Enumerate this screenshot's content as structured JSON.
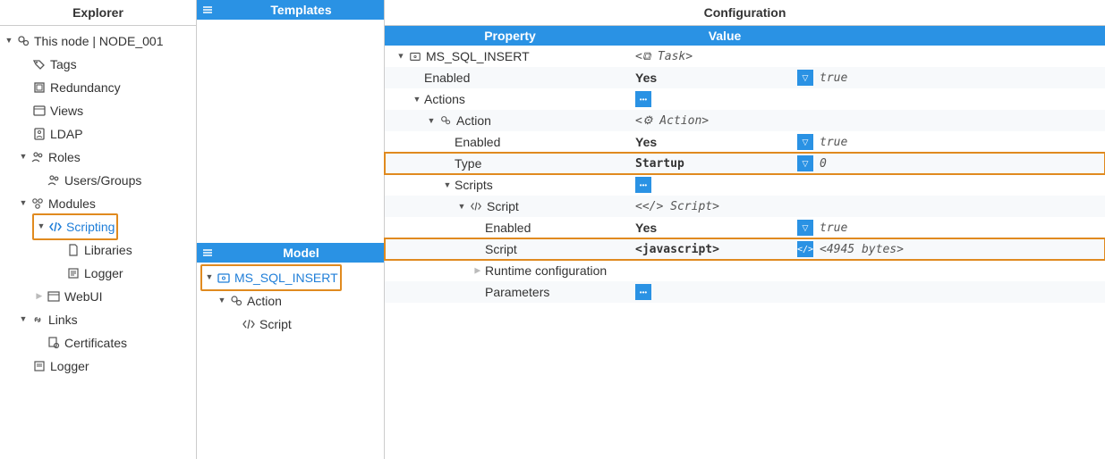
{
  "explorer": {
    "title": "Explorer",
    "node": "This node | NODE_001",
    "items": {
      "tags": "Tags",
      "redundancy": "Redundancy",
      "views": "Views",
      "ldap": "LDAP",
      "roles": "Roles",
      "usersgroups": "Users/Groups",
      "modules": "Modules",
      "scripting": "Scripting",
      "libraries": "Libraries",
      "logger": "Logger",
      "webui": "WebUI",
      "links": "Links",
      "certificates": "Certificates",
      "logger2": "Logger"
    }
  },
  "mid": {
    "templates_title": "Templates",
    "model_title": "Model",
    "model": {
      "root": "MS_SQL_INSERT",
      "action": "Action",
      "script": "Script"
    }
  },
  "config": {
    "title": "Configuration",
    "headers": {
      "property": "Property",
      "value": "Value"
    },
    "rows": {
      "root": {
        "p": "MS_SQL_INSERT",
        "v": "<⧉ Task>"
      },
      "enabled1": {
        "p": "Enabled",
        "v": "Yes",
        "e": "true"
      },
      "actions": {
        "p": "Actions"
      },
      "action": {
        "p": "Action",
        "v": "<⚙ Action>"
      },
      "enabled2": {
        "p": "Enabled",
        "v": "Yes",
        "e": "true"
      },
      "type": {
        "p": "Type",
        "v": "Startup",
        "e": "0"
      },
      "scripts": {
        "p": "Scripts"
      },
      "script": {
        "p": "Script",
        "v": "<</> Script>"
      },
      "enabled3": {
        "p": "Enabled",
        "v": "Yes",
        "e": "true"
      },
      "scriptv": {
        "p": "Script",
        "v": "<javascript>",
        "e": "<4945 bytes>"
      },
      "runtime": {
        "p": "Runtime configuration"
      },
      "params": {
        "p": "Parameters"
      }
    }
  }
}
